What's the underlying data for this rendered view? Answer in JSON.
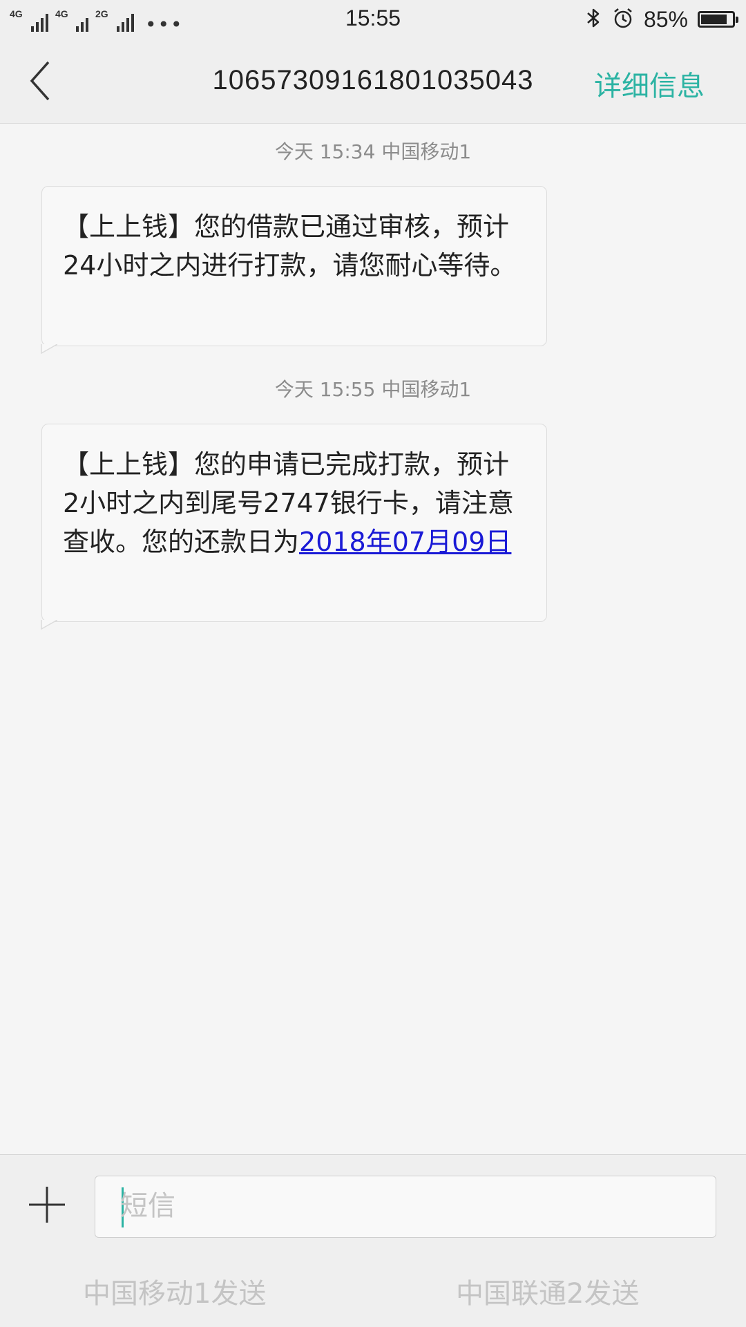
{
  "status_bar": {
    "net1_label": "4G",
    "net2_label": "4G",
    "net3_label": "2G",
    "more": "•••",
    "time": "15:55",
    "battery_percent_text": "85%",
    "battery_level": 0.85
  },
  "header": {
    "title": "10657309161801035043",
    "details_label": "详细信息"
  },
  "messages": [
    {
      "timestamp": "今天  15:34  中国移动1",
      "text": "【上上钱】您的借款已通过审核，预计24小时之内进行打款，请您耐心等待。"
    },
    {
      "timestamp": "今天  15:55  中国移动1",
      "text": "【上上钱】您的申请已完成打款，预计2小时之内到尾号2747银行卡，请注意查收。您的还款日为",
      "link": "2018年07月09日"
    }
  ],
  "composer": {
    "placeholder": "短信",
    "send_sim1": "中国移动1发送",
    "send_sim2": "中国联通2发送"
  },
  "colors": {
    "accent": "#2bb3a3",
    "link": "#1a1ad6",
    "background": "#f5f5f5"
  }
}
